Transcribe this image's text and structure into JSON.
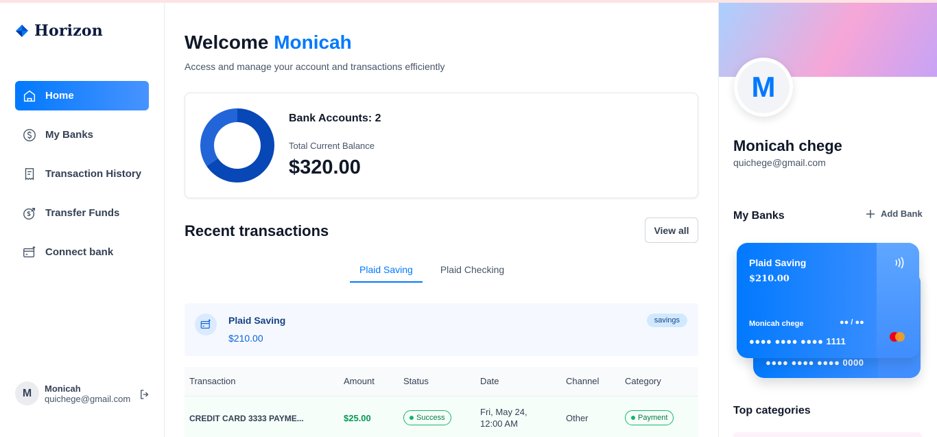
{
  "app": {
    "name": "Horizon"
  },
  "sidebar": {
    "items": [
      {
        "label": "Home",
        "icon": "home-icon",
        "active": true
      },
      {
        "label": "My Banks",
        "icon": "dollar-circle-icon",
        "active": false
      },
      {
        "label": "Transaction History",
        "icon": "receipt-icon",
        "active": false
      },
      {
        "label": "Transfer Funds",
        "icon": "money-send-icon",
        "active": false
      },
      {
        "label": "Connect bank",
        "icon": "card-add-icon",
        "active": false
      }
    ],
    "footer": {
      "initial": "M",
      "name": "Monicah",
      "email": "quichege@gmail.com"
    }
  },
  "header": {
    "greeting": "Welcome",
    "user": "Monicah",
    "subtitle": "Access and manage your account and transactions efficiently"
  },
  "balance": {
    "accounts_label": "Bank Accounts: 2",
    "total_label": "Total Current Balance",
    "total_value": "$320.00",
    "donut": {
      "colors": [
        "#0747b6",
        "#2265d8"
      ],
      "values": [
        210,
        110
      ]
    }
  },
  "recent": {
    "title": "Recent transactions",
    "view_all": "View all",
    "tabs": [
      "Plaid Saving",
      "Plaid Checking"
    ],
    "account": {
      "name": "Plaid Saving",
      "balance": "$210.00",
      "badge": "savings"
    },
    "columns": [
      "Transaction",
      "Amount",
      "Status",
      "Date",
      "Channel",
      "Category"
    ],
    "rows": [
      {
        "name": "CREDIT CARD 3333 PAYME...",
        "amount": "$25.00",
        "status": "Success",
        "date_line1": "Fri, May 24,",
        "date_line2": "12:00 AM",
        "channel": "Other",
        "category": "Payment"
      }
    ]
  },
  "profile": {
    "initial": "M",
    "name": "Monicah chege",
    "email": "quichege@gmail.com"
  },
  "banks": {
    "title": "My Banks",
    "add_label": "Add Bank",
    "cards": [
      {
        "name": "Plaid Saving",
        "balance": "$210.00",
        "holder": "Monicah chege",
        "expiry": "●● / ●●",
        "number": "●●●● ●●●● ●●●● 1111"
      },
      {
        "number": "●●●● ●●●● ●●●● 0000"
      }
    ]
  },
  "categories": {
    "title": "Top categories"
  },
  "colors": {
    "accent": "#0179fe",
    "success": "#12b76a",
    "strip_bg": "#f5f9ff"
  }
}
